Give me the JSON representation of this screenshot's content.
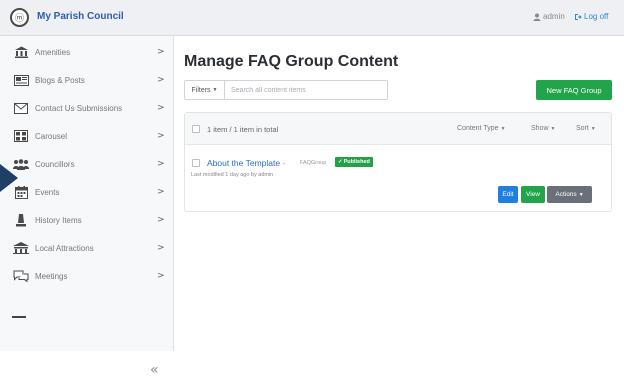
{
  "header": {
    "brand": "My Parish Council",
    "logo_glyph": "ⓜ",
    "user_label": "admin",
    "logoff_label": "Log off"
  },
  "sidebar": {
    "items": [
      {
        "label": "Amenities",
        "icon": "building-icon"
      },
      {
        "label": "Blogs & Posts",
        "icon": "newspaper-icon"
      },
      {
        "label": "Contact Us Submissions",
        "icon": "envelope-icon"
      },
      {
        "label": "Carousel",
        "icon": "images-icon"
      },
      {
        "label": "Councillors",
        "icon": "users-icon"
      },
      {
        "label": "Events",
        "icon": "calendar-icon"
      },
      {
        "label": "History Items",
        "icon": "landmark-icon"
      },
      {
        "label": "Local Attractions",
        "icon": "map-icon"
      },
      {
        "label": "Meetings",
        "icon": "comments-icon"
      }
    ],
    "chevron": ">",
    "collapse_glyph": "«"
  },
  "main": {
    "title": "Manage FAQ Group Content",
    "filters_label": "Filters",
    "search_placeholder": "Search all content items",
    "new_button": "New FAQ Group",
    "list": {
      "count_label": "1 item / 1 item in total",
      "content_type_label": "Content Type",
      "show_label": "Show",
      "sort_label": "Sort",
      "rows": [
        {
          "title": "About the Template",
          "separator": "-",
          "type": "FAQGroup",
          "status": "Published",
          "meta": "Last modified 1 day ago by admin",
          "edit": "Edit",
          "view": "View",
          "actions": "Actions"
        }
      ]
    }
  },
  "colors": {
    "accent_blue": "#2a5db0",
    "green": "#22a44a",
    "edit_blue": "#1e7fe0",
    "actions_gray": "#6a7078"
  }
}
